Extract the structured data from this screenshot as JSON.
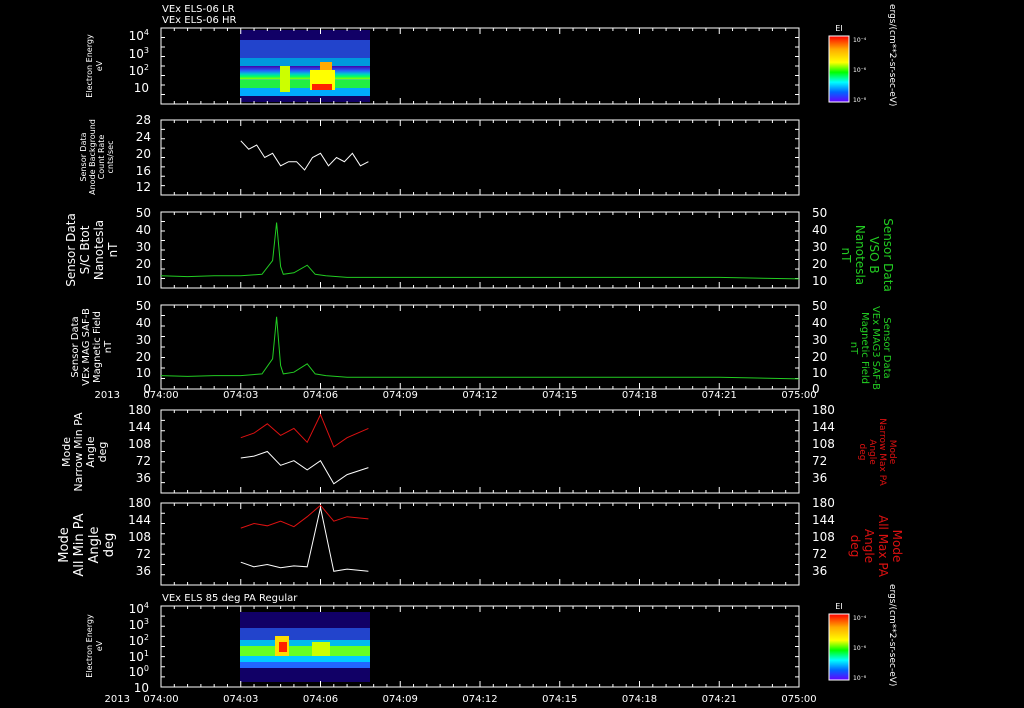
{
  "colors": {
    "white": "#ffffff",
    "green": "#22cc22",
    "red": "#dd1111",
    "background": "#000000"
  },
  "header": {
    "line1": "VEx ELS-06 LR",
    "line2": "VEx ELS-06 HR"
  },
  "time_axis": {
    "year": "2013",
    "ticks": [
      "074:00",
      "074:03",
      "074:06",
      "074:09",
      "074:12",
      "074:15",
      "074:18",
      "074:21",
      "075:00"
    ]
  },
  "colorbar": {
    "label": "EI",
    "ticks": [
      "10⁻⁴",
      "10⁻⁶",
      "10⁻⁸"
    ],
    "units": "ergs/(cm**2-sr-sec-eV)"
  },
  "panels": {
    "p1": {
      "ylabel": [
        "Electron Energy",
        "eV"
      ],
      "yticks": [
        {
          "b": "10",
          "e": "4"
        },
        {
          "b": "10",
          "e": "3"
        },
        {
          "b": "10",
          "e": "2"
        },
        {
          "b": "10",
          "e": ""
        }
      ]
    },
    "p2": {
      "ylabel": [
        "Sensor Data",
        "Anode Background",
        "Count Rate",
        "cnts/sec"
      ],
      "yticks": [
        "28",
        "24",
        "20",
        "16",
        "12"
      ]
    },
    "p3": {
      "ylabel": [
        "Sensor Data",
        "S/C Btot",
        "Nanotesla",
        "nT"
      ],
      "rlabel": [
        "Sensor Data",
        "VSO B",
        "Nanotesla",
        "nT"
      ],
      "yticks": [
        "50",
        "40",
        "30",
        "20",
        "10"
      ]
    },
    "p4": {
      "ylabel": [
        "Sensor Data",
        "VEx MAG SAF-B",
        "Magnetic Field",
        "nT"
      ],
      "rlabel": [
        "Sensor Data",
        "VEx MAG3 SAF-B",
        "Magnetic Field",
        "nT"
      ],
      "yticks": [
        "50",
        "40",
        "30",
        "20",
        "10",
        "0"
      ]
    },
    "p5": {
      "ylabel": [
        "Mode",
        "Narrow Min PA",
        "Angle",
        "deg"
      ],
      "rlabel": [
        "Mode",
        "Narrow Max PA",
        "Angle",
        "deg"
      ],
      "yticks": [
        "180",
        "144",
        "108",
        "72",
        "36"
      ]
    },
    "p6": {
      "ylabel": [
        "Mode",
        "All Min PA",
        "Angle",
        "deg"
      ],
      "rlabel": [
        "Mode",
        "All Max PA",
        "Angle",
        "deg"
      ],
      "yticks": [
        "180",
        "144",
        "108",
        "72",
        "36"
      ]
    },
    "p7": {
      "title": "VEx ELS 85 deg PA Regular",
      "ylabel": [
        "Electron Energy",
        "eV"
      ],
      "yticks": [
        {
          "b": "10",
          "e": "4"
        },
        {
          "b": "10",
          "e": "3"
        },
        {
          "b": "10",
          "e": "2"
        },
        {
          "b": "10",
          "e": "1"
        },
        {
          "b": "10",
          "e": "0"
        },
        {
          "b": "10",
          "e": ""
        }
      ]
    }
  },
  "chart_data": [
    {
      "type": "heatmap",
      "panel": "p1",
      "x_range_hours": [
        0,
        24
      ],
      "data_hours": [
        3.0,
        7.8
      ],
      "y_log_range": [
        1,
        10000
      ],
      "description_values": {
        "intense_band_ev": [
          10,
          30
        ],
        "peak_time_hours": 6.0
      }
    },
    {
      "type": "line",
      "panel": "p2",
      "ylim": [
        10,
        28
      ],
      "x": [
        3.0,
        3.3,
        3.6,
        3.9,
        4.2,
        4.5,
        4.8,
        5.1,
        5.4,
        5.7,
        6.0,
        6.3,
        6.6,
        6.9,
        7.2,
        7.5,
        7.8
      ],
      "y": [
        23,
        21,
        22,
        19,
        20,
        17,
        18,
        18,
        16,
        19,
        20,
        17,
        19,
        18,
        20,
        17,
        18
      ]
    },
    {
      "type": "line",
      "panel": "p3",
      "ylim": [
        0,
        50
      ],
      "x": [
        0,
        1,
        2,
        3,
        3.8,
        4.2,
        4.35,
        4.5,
        4.6,
        5.0,
        5.5,
        5.8,
        6.2,
        7,
        9,
        12,
        15,
        18,
        21,
        24
      ],
      "y": [
        8,
        7.5,
        8,
        8,
        9,
        18,
        43,
        14,
        9,
        10,
        15,
        9,
        8,
        7,
        7,
        7,
        7,
        7,
        7,
        6
      ]
    },
    {
      "type": "line",
      "panel": "p4",
      "ylim": [
        0,
        50
      ],
      "x": [
        0,
        1,
        2,
        3,
        3.8,
        4.2,
        4.35,
        4.5,
        4.6,
        5.0,
        5.5,
        5.8,
        6.2,
        7,
        9,
        12,
        15,
        18,
        21,
        24
      ],
      "y": [
        8,
        7.5,
        8,
        8,
        9,
        18,
        43,
        14,
        9,
        10,
        15,
        9,
        8,
        7,
        7,
        7,
        7,
        7,
        7,
        6
      ]
    },
    {
      "type": "line",
      "panel": "p5",
      "ylim": [
        0,
        180
      ],
      "series": [
        {
          "x": [
            3.0,
            3.5,
            4.0,
            4.5,
            5.0,
            5.5,
            6.0,
            6.5,
            7.0,
            7.8
          ],
          "y": [
            76,
            80,
            90,
            60,
            70,
            50,
            70,
            20,
            40,
            55
          ]
        },
        {
          "x": [
            3.0,
            3.5,
            4.0,
            4.5,
            5.0,
            5.5,
            6.0,
            6.5,
            7.0,
            7.8
          ],
          "y": [
            120,
            130,
            150,
            125,
            140,
            110,
            170,
            100,
            120,
            140
          ]
        }
      ]
    },
    {
      "type": "line",
      "panel": "p6",
      "ylim": [
        0,
        180
      ],
      "series": [
        {
          "x": [
            3.0,
            3.5,
            4.0,
            4.5,
            5.0,
            5.5,
            6.0,
            6.5,
            7.0,
            7.8
          ],
          "y": [
            50,
            40,
            45,
            38,
            42,
            40,
            170,
            30,
            35,
            30
          ]
        },
        {
          "x": [
            3.0,
            3.5,
            4.0,
            4.5,
            5.0,
            5.5,
            6.0,
            6.5,
            7.0,
            7.8
          ],
          "y": [
            125,
            135,
            130,
            140,
            128,
            150,
            175,
            140,
            150,
            145
          ]
        }
      ]
    },
    {
      "type": "heatmap",
      "panel": "p7",
      "x_range_hours": [
        0,
        24
      ],
      "data_hours": [
        3.0,
        7.8
      ],
      "y_log_range": [
        0.1,
        10000
      ],
      "description_values": {
        "intense_band_ev": [
          10,
          100
        ],
        "peak_time_hours": 4.6
      }
    }
  ]
}
